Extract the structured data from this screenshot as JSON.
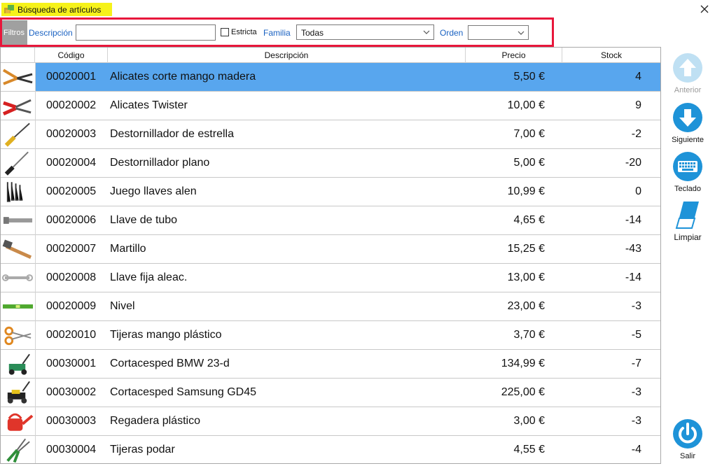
{
  "window": {
    "title": "Búsqueda de artículos",
    "close_icon": "close-icon"
  },
  "filters": {
    "tag": "Filtros",
    "description_label": "Descripción",
    "description_value": "",
    "strict_label": "Estricta",
    "strict_checked": false,
    "family_label": "Familia",
    "family_value": "Todas",
    "order_label": "Orden",
    "order_value": ""
  },
  "table": {
    "columns": [
      "Código",
      "Descripción",
      "Precio",
      "Stock"
    ],
    "selected_index": 0,
    "rows": [
      {
        "code": "00020001",
        "description": "Alicates corte mango madera",
        "price": "5,50 €",
        "stock": "4",
        "thumb": "pliers-cutting-thumb"
      },
      {
        "code": "00020002",
        "description": "Alicates Twister",
        "price": "10,00 €",
        "stock": "9",
        "thumb": "pliers-twister-thumb"
      },
      {
        "code": "00020003",
        "description": "Destornillador de estrella",
        "price": "7,00 €",
        "stock": "-2",
        "thumb": "screwdriver-phillips-thumb"
      },
      {
        "code": "00020004",
        "description": "Destornillador plano",
        "price": "5,00 €",
        "stock": "-20",
        "thumb": "screwdriver-flat-thumb"
      },
      {
        "code": "00020005",
        "description": "Juego llaves alen",
        "price": "10,99 €",
        "stock": "0",
        "thumb": "allen-keys-thumb"
      },
      {
        "code": "00020006",
        "description": "Llave de tubo",
        "price": "4,65 €",
        "stock": "-14",
        "thumb": "tube-wrench-thumb"
      },
      {
        "code": "00020007",
        "description": "Martillo",
        "price": "15,25 €",
        "stock": "-43",
        "thumb": "hammer-thumb"
      },
      {
        "code": "00020008",
        "description": "Llave fija aleac.",
        "price": "13,00 €",
        "stock": "-14",
        "thumb": "open-wrench-thumb"
      },
      {
        "code": "00020009",
        "description": "Nivel",
        "price": "23,00 €",
        "stock": "-3",
        "thumb": "level-thumb"
      },
      {
        "code": "00020010",
        "description": "Tijeras mango plástico",
        "price": "3,70 €",
        "stock": "-5",
        "thumb": "scissors-thumb"
      },
      {
        "code": "00030001",
        "description": "Cortacesped BMW 23-d",
        "price": "134,99 €",
        "stock": "-7",
        "thumb": "lawnmower-green-thumb"
      },
      {
        "code": "00030002",
        "description": "Cortacesped Samsung GD45",
        "price": "225,00 €",
        "stock": "-3",
        "thumb": "lawnmower-yellow-thumb"
      },
      {
        "code": "00030003",
        "description": "Regadera plástico",
        "price": "3,00 €",
        "stock": "-3",
        "thumb": "watering-can-thumb"
      },
      {
        "code": "00030004",
        "description": "Tijeras podar",
        "price": "4,55 €",
        "stock": "-4",
        "thumb": "pruning-shears-thumb"
      }
    ]
  },
  "sidebar": {
    "previous_label": "Anterior",
    "next_label": "Siguiente",
    "keyboard_label": "Teclado",
    "clear_label": "Limpiar",
    "exit_label": "Salir"
  },
  "colors": {
    "accent": "#1e93d8",
    "selection": "#58a6ee",
    "highlight_outline": "#e8173b",
    "title_highlight": "#f6f21a"
  }
}
